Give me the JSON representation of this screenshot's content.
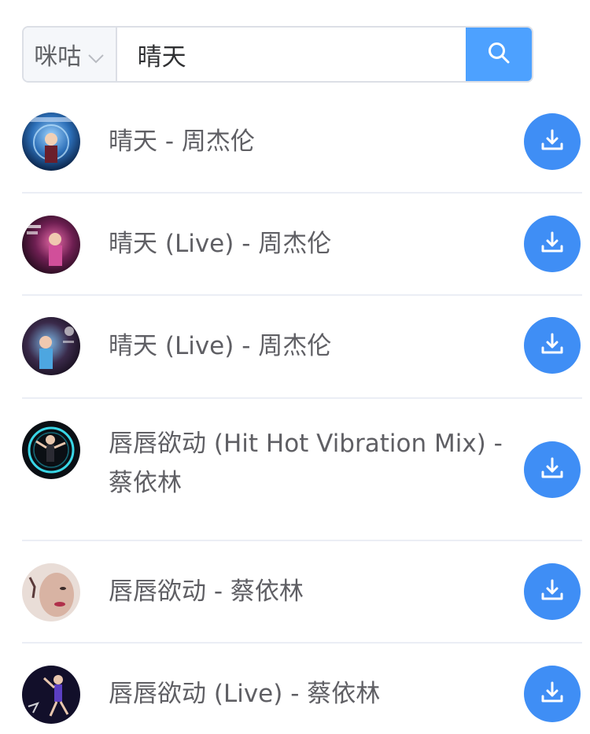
{
  "search": {
    "source": "咪咕",
    "query": "晴天"
  },
  "songs": [
    {
      "title": "晴天 - 周杰伦"
    },
    {
      "title": "晴天 (Live) - 周杰伦"
    },
    {
      "title": "晴天 (Live) - 周杰伦"
    },
    {
      "title": "唇唇欲动 (Hit Hot Vibration Mix) - 蔡依林"
    },
    {
      "title": "唇唇欲动 - 蔡依林"
    },
    {
      "title": "唇唇欲动 (Live) - 蔡依林"
    }
  ],
  "icons": {
    "search_button": "search-icon",
    "select": "chevron-down-icon",
    "row_action": "download-icon"
  },
  "colors": {
    "accent": "#4da1ff",
    "download": "#3f8ef5",
    "text": "#5f5f64"
  }
}
